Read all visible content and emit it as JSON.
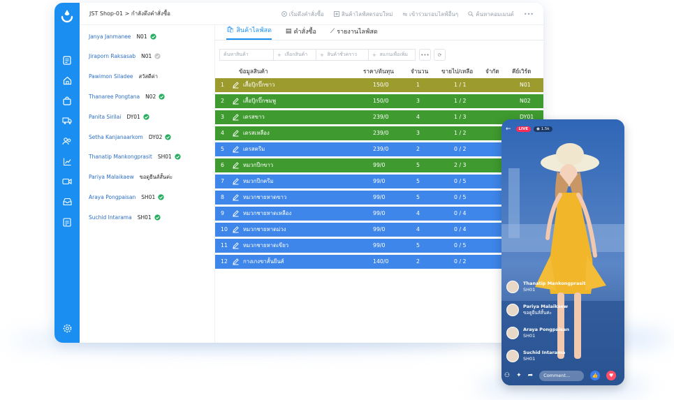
{
  "header": {
    "breadcrumb": "JST Shop-01 > กำลังดึงคำสั่งซื้อ"
  },
  "toolbar": {
    "start_orders": "เริ่มดึงคำสั่งซื้อ",
    "new_products": "สินค้าไลฟ์สดรอบใหม่",
    "join_live": "เข้าร่วมรอบไลฟ์อื่นๆ",
    "search_comments": "ค้นหาคอมเมนต์",
    "more": "•••"
  },
  "sidebar": {
    "items": [
      {
        "name": "Janya Janmanee",
        "code": "N01",
        "status": "done"
      },
      {
        "name": "Jiraporn Raksasab",
        "code": "N01",
        "status": "pending"
      },
      {
        "name": "Pawimon Siladee",
        "code": "สวัสดีค่า",
        "status": "none"
      },
      {
        "name": "Thanaree Pongtana",
        "code": "N02",
        "status": "done"
      },
      {
        "name": "Panita Sirilai",
        "code": "DY01",
        "status": "done"
      },
      {
        "name": "Setha Kanjanaarkom",
        "code": "DY02",
        "status": "done"
      },
      {
        "name": "Thanatip Mankongprasit",
        "code": "SH01",
        "status": "done"
      },
      {
        "name": "Pariya Malaikaew",
        "code": "ขอดูยีนส์สั้นค่ะ",
        "status": "none"
      },
      {
        "name": "Araya Pongpaisan",
        "code": "SH01",
        "status": "done"
      },
      {
        "name": "Suchid Intarama",
        "code": "SH01",
        "status": "done"
      }
    ]
  },
  "tabs": [
    {
      "label": "สินค้าไลฟ์สด"
    },
    {
      "label": "คำสั่งซื้อ"
    },
    {
      "label": "รายงานไลฟ์สด"
    }
  ],
  "filters": {
    "product_search": "ค้นหาสินค้า",
    "choose_product": "เลือกสินค้า",
    "temp_product": "สินค้าชั่วคราว",
    "scan_add": "สแกนเพื่อเพิ่ม",
    "more": "•••"
  },
  "table": {
    "headers": {
      "info": "ข้อมูลสินค้า",
      "price": "ราคา/ต้นทุน",
      "qty": "จำนวน",
      "sold": "ขายไป/เหลือ",
      "limit": "จำกัด",
      "keyword": "คีย์เวิร์ด"
    },
    "rows": [
      {
        "no": "1",
        "name": "เสื้อปุ๊กปิ๊กขาว",
        "price": "150/0",
        "qty": "1",
        "sold": "1 / 1",
        "keyword": "N01",
        "color": "#9c9b2d"
      },
      {
        "no": "2",
        "name": "เสื้อปุ๊กปิ๊กชมพู",
        "price": "150/0",
        "qty": "3",
        "sold": "1 / 2",
        "keyword": "N02",
        "color": "#3f9a2f"
      },
      {
        "no": "3",
        "name": "เดรสขาว",
        "price": "239/0",
        "qty": "4",
        "sold": "1 / 3",
        "keyword": "DY01",
        "color": "#3f9a2f"
      },
      {
        "no": "4",
        "name": "เดรสเหลือง",
        "price": "239/0",
        "qty": "3",
        "sold": "1 / 2",
        "keyword": "",
        "color": "#3f9a2f"
      },
      {
        "no": "5",
        "name": "เดรสครีม",
        "price": "239/0",
        "qty": "2",
        "sold": "0 / 2",
        "keyword": "",
        "color": "#3e86ea"
      },
      {
        "no": "6",
        "name": "หมวกปีกขาว",
        "price": "99/0",
        "qty": "5",
        "sold": "2 / 3",
        "keyword": "",
        "color": "#3f9a2f"
      },
      {
        "no": "7",
        "name": "หมวกปีกครีม",
        "price": "99/0",
        "qty": "5",
        "sold": "0 / 5",
        "keyword": "",
        "color": "#3e86ea"
      },
      {
        "no": "8",
        "name": "หมวกชายหาดขาว",
        "price": "99/0",
        "qty": "5",
        "sold": "0 / 5",
        "keyword": "",
        "color": "#3e86ea"
      },
      {
        "no": "9",
        "name": "หมวกชายหาดเหลือง",
        "price": "99/0",
        "qty": "4",
        "sold": "0 / 4",
        "keyword": "",
        "color": "#3e86ea"
      },
      {
        "no": "10",
        "name": "หมวกชายหาดม่วง",
        "price": "99/0",
        "qty": "4",
        "sold": "0 / 4",
        "keyword": "",
        "color": "#3e86ea"
      },
      {
        "no": "11",
        "name": "หมวกชายหาดเขียว",
        "price": "99/0",
        "qty": "5",
        "sold": "0 / 5",
        "keyword": "",
        "color": "#3e86ea"
      },
      {
        "no": "12",
        "name": "กางเกงขาสั้นยีนส์",
        "price": "140/0",
        "qty": "2",
        "sold": "0 / 2",
        "keyword": "",
        "color": "#3e86ea"
      }
    ]
  },
  "phone": {
    "live_badge": "LIVE",
    "viewers": "1.5k",
    "comments": [
      {
        "user": "Thanatip Mankongprasit",
        "text": "SH01"
      },
      {
        "user": "Pariya Malaikaew",
        "text": "ขอดูยีนส์สั้นค่ะ"
      },
      {
        "user": "Araya Pongpaisan",
        "text": "SH01"
      },
      {
        "user": "Suchid Intarama",
        "text": "SH01"
      }
    ],
    "comment_placeholder": "Comment..."
  },
  "colors": {
    "brand": "#1a8ff1",
    "row_olive": "#9c9b2d",
    "row_green": "#3f9a2f",
    "row_blue": "#3e86ea",
    "live": "#ff2d55"
  }
}
